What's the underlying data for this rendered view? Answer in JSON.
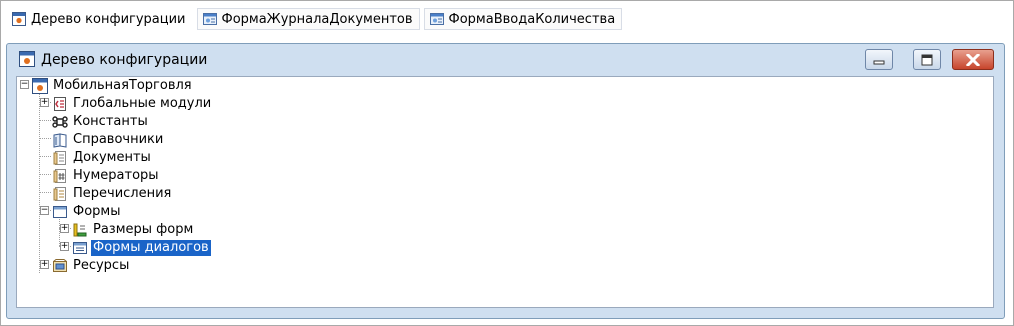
{
  "tabs": [
    {
      "label": "Дерево конфигурации",
      "icon": "config-tree-icon",
      "active": true
    },
    {
      "label": "ФормаЖурналаДокументов",
      "icon": "form-icon",
      "active": false
    },
    {
      "label": "ФормаВводаКоличества",
      "icon": "form-icon",
      "active": false
    }
  ],
  "window": {
    "title": "Дерево конфигурации",
    "minimize_icon": "minimize-icon",
    "maximize_icon": "maximize-icon",
    "close_icon": "close-icon"
  },
  "tree": {
    "root": {
      "label": "МобильнаяТорговля",
      "expanded": true,
      "icon": "configuration-icon"
    },
    "items": [
      {
        "label": "Глобальные модули",
        "icon": "modules-icon",
        "has_children": true,
        "expanded": false
      },
      {
        "label": "Константы",
        "icon": "constants-icon",
        "has_children": false
      },
      {
        "label": "Справочники",
        "icon": "catalogs-icon",
        "has_children": false
      },
      {
        "label": "Документы",
        "icon": "documents-icon",
        "has_children": false
      },
      {
        "label": "Нумераторы",
        "icon": "numerators-icon",
        "has_children": false
      },
      {
        "label": "Перечисления",
        "icon": "enums-icon",
        "has_children": false
      },
      {
        "label": "Формы",
        "icon": "forms-icon",
        "has_children": true,
        "expanded": true,
        "children": [
          {
            "label": "Размеры форм",
            "icon": "form-sizes-icon",
            "has_children": true,
            "expanded": false
          },
          {
            "label": "Формы диалогов",
            "icon": "dialog-forms-icon",
            "has_children": true,
            "expanded": false,
            "selected": true
          }
        ]
      },
      {
        "label": "Ресурсы",
        "icon": "resources-icon",
        "has_children": true,
        "expanded": false
      }
    ]
  },
  "colors": {
    "selection": "#1a64c8",
    "window_frame": "#cfdff0",
    "close_button": "#c7452c"
  }
}
